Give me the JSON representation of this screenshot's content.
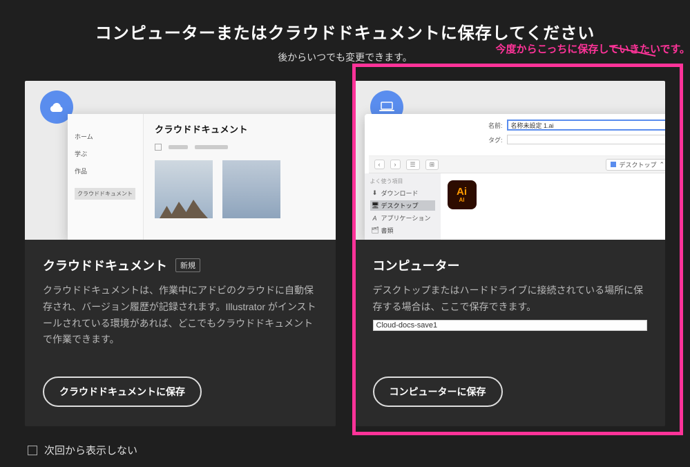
{
  "header": {
    "title": "コンピューターまたはクラウドドキュメントに保存してください",
    "subtitle": "後からいつでも変更できます。"
  },
  "annotation": "今度からこっちに保存していきたいです。",
  "cloud_card": {
    "title": "クラウドドキュメント",
    "badge": "新規",
    "desc": "クラウドドキュメントは、作業中にアドビのクラウドに自動保存され、バージョン履歴が記録されます。Illustrator がインストールされている環境があれば、どこでもクラウドドキュメントで作業できます。",
    "button": "クラウドドキュメントに保存",
    "preview": {
      "heading": "クラウドドキュメント",
      "side": {
        "home": "ホーム",
        "learn": "学ぶ",
        "works": "作品",
        "pill": "クラウドドキュメント"
      }
    }
  },
  "computer_card": {
    "title": "コンピューター",
    "desc": "デスクトップまたはハードドライブに接続されている場所に保存する場合は、ここで保存できます。",
    "tooltip": "Cloud-docs-save1",
    "button": "コンピューターに保存",
    "preview": {
      "name_label": "名前:",
      "name_value": "名称未設定 1.ai",
      "tag_label": "タグ:",
      "location": "デスクトップ",
      "toolbar": {
        "back": "‹",
        "fwd": "›",
        "view": "☰",
        "grid": "⊞"
      },
      "sidebar": {
        "header": "よく使う項目",
        "items": [
          {
            "glyph": "⬇",
            "label": "ダウンロード"
          },
          {
            "glyph": "🖥",
            "label": "デスクトップ"
          },
          {
            "glyph": "A",
            "label": "アプリケーション"
          },
          {
            "glyph": "🗂",
            "label": "書類"
          }
        ]
      },
      "ai": {
        "big": "Ai",
        "small": "AI"
      }
    }
  },
  "footer": {
    "dont_show": "次回から表示しない"
  }
}
